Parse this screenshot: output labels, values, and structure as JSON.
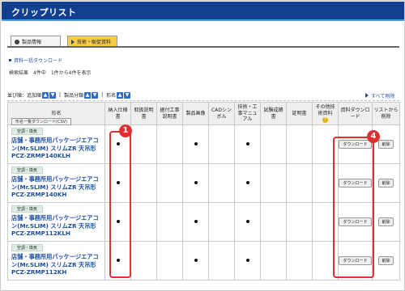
{
  "header": {
    "title": "クリップリスト"
  },
  "tabs": [
    {
      "label": "製品情報"
    },
    {
      "label": "技術・販促資料"
    }
  ],
  "links": {
    "bulk_download": "資料一括ダウンロード"
  },
  "search_result": "検索結果　4件中　1件から4件を表示",
  "sort": {
    "label": "並び順：追加順",
    "category": "製品分類",
    "model": "形名",
    "up": "▲",
    "down": "▼"
  },
  "delete_all": "すべて削除",
  "table": {
    "headers": [
      "形名",
      "納入仕様書",
      "取扱説明書",
      "据付工事説明書",
      "製品画像",
      "CADシンボル",
      "技術・工事マニュアル",
      "試験成績書",
      "証明書",
      "その他技術資料",
      "資料ダウンロード",
      "リストから削除"
    ],
    "csv_button": "形名一覧ダウンロード(CSV)",
    "download_label": "ダウンロード",
    "delete_label": "削除",
    "rows": [
      {
        "category": "空調・換気",
        "name": "店舗・事務所用パッケージエアコン(Mr.SLIM) スリムZR 天吊形 PCZ-ZRMP140KLH",
        "dots": [
          true,
          false,
          false,
          true,
          false,
          true,
          false,
          false,
          false
        ]
      },
      {
        "category": "空調・換気",
        "name": "店舗・事務所用パッケージエアコン(Mr.SLIM) スリムZR 天吊形 PCZ-ZRMP140KH",
        "dots": [
          true,
          false,
          false,
          true,
          false,
          true,
          false,
          false,
          false
        ]
      },
      {
        "category": "空調・換気",
        "name": "店舗・事務所用パッケージエアコン(Mr.SLIM) スリムZR 天吊形 PCZ-ZRMP112KLH",
        "dots": [
          true,
          false,
          false,
          true,
          false,
          true,
          false,
          false,
          false
        ]
      },
      {
        "category": "空調・換気",
        "name": "店舗・事務所用パッケージエアコン(Mr.SLIM) スリムZR 天吊形 PCZ-ZRMP112KH",
        "dots": [
          true,
          false,
          false,
          true,
          false,
          true,
          false,
          false,
          false
        ]
      }
    ]
  },
  "callouts": [
    "1",
    "4"
  ],
  "colors": {
    "header_bg": "#123f8f",
    "accent": "#e03030",
    "link": "#1c4fa3"
  }
}
